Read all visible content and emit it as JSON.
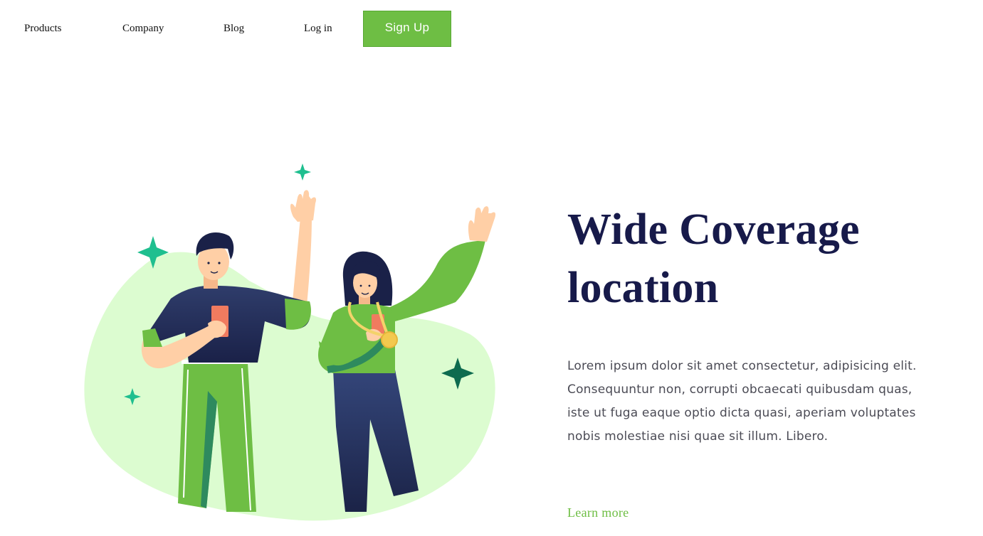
{
  "nav": {
    "items": [
      {
        "label": "Products"
      },
      {
        "label": "Company"
      },
      {
        "label": "Blog"
      },
      {
        "label": "Log in"
      }
    ],
    "signup_label": "Sign Up"
  },
  "hero": {
    "title_line1": "Wide Coverage",
    "title_line2": "location",
    "body": "Lorem ipsum dolor sit amet consectetur, adipisicing elit. Consequuntur non, corrupti obcaecati quibusdam quas, iste ut fuga eaque optio dicta quasi, aperiam voluptates nobis molestiae nisi quae sit illum. Libero.",
    "cta_label": "Learn more"
  },
  "colors": {
    "accent_green": "#6ebe44",
    "title_navy": "#171a4a",
    "blob_mint": "#dcfcd0",
    "sparkle_teal": "#1fbf8f",
    "sparkle_dark": "#0e6b4f"
  },
  "illustration": {
    "subject": "two-people-waving-with-phones",
    "icons": [
      "sparkle-icon",
      "phone-icon",
      "medal-icon"
    ]
  }
}
